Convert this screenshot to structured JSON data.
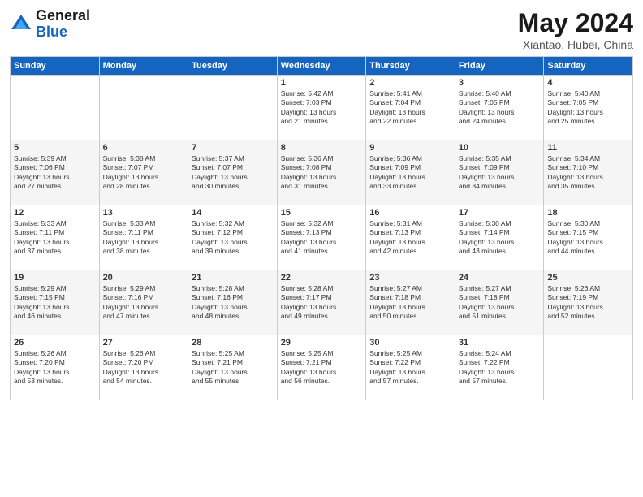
{
  "logo": {
    "general": "General",
    "blue": "Blue"
  },
  "title": "May 2024",
  "subtitle": "Xiantao, Hubei, China",
  "days_of_week": [
    "Sunday",
    "Monday",
    "Tuesday",
    "Wednesday",
    "Thursday",
    "Friday",
    "Saturday"
  ],
  "weeks": [
    [
      {
        "day": "",
        "info": ""
      },
      {
        "day": "",
        "info": ""
      },
      {
        "day": "",
        "info": ""
      },
      {
        "day": "1",
        "info": "Sunrise: 5:42 AM\nSunset: 7:03 PM\nDaylight: 13 hours\nand 21 minutes."
      },
      {
        "day": "2",
        "info": "Sunrise: 5:41 AM\nSunset: 7:04 PM\nDaylight: 13 hours\nand 22 minutes."
      },
      {
        "day": "3",
        "info": "Sunrise: 5:40 AM\nSunset: 7:05 PM\nDaylight: 13 hours\nand 24 minutes."
      },
      {
        "day": "4",
        "info": "Sunrise: 5:40 AM\nSunset: 7:05 PM\nDaylight: 13 hours\nand 25 minutes."
      }
    ],
    [
      {
        "day": "5",
        "info": "Sunrise: 5:39 AM\nSunset: 7:06 PM\nDaylight: 13 hours\nand 27 minutes."
      },
      {
        "day": "6",
        "info": "Sunrise: 5:38 AM\nSunset: 7:07 PM\nDaylight: 13 hours\nand 28 minutes."
      },
      {
        "day": "7",
        "info": "Sunrise: 5:37 AM\nSunset: 7:07 PM\nDaylight: 13 hours\nand 30 minutes."
      },
      {
        "day": "8",
        "info": "Sunrise: 5:36 AM\nSunset: 7:08 PM\nDaylight: 13 hours\nand 31 minutes."
      },
      {
        "day": "9",
        "info": "Sunrise: 5:36 AM\nSunset: 7:09 PM\nDaylight: 13 hours\nand 33 minutes."
      },
      {
        "day": "10",
        "info": "Sunrise: 5:35 AM\nSunset: 7:09 PM\nDaylight: 13 hours\nand 34 minutes."
      },
      {
        "day": "11",
        "info": "Sunrise: 5:34 AM\nSunset: 7:10 PM\nDaylight: 13 hours\nand 35 minutes."
      }
    ],
    [
      {
        "day": "12",
        "info": "Sunrise: 5:33 AM\nSunset: 7:11 PM\nDaylight: 13 hours\nand 37 minutes."
      },
      {
        "day": "13",
        "info": "Sunrise: 5:33 AM\nSunset: 7:11 PM\nDaylight: 13 hours\nand 38 minutes."
      },
      {
        "day": "14",
        "info": "Sunrise: 5:32 AM\nSunset: 7:12 PM\nDaylight: 13 hours\nand 39 minutes."
      },
      {
        "day": "15",
        "info": "Sunrise: 5:32 AM\nSunset: 7:13 PM\nDaylight: 13 hours\nand 41 minutes."
      },
      {
        "day": "16",
        "info": "Sunrise: 5:31 AM\nSunset: 7:13 PM\nDaylight: 13 hours\nand 42 minutes."
      },
      {
        "day": "17",
        "info": "Sunrise: 5:30 AM\nSunset: 7:14 PM\nDaylight: 13 hours\nand 43 minutes."
      },
      {
        "day": "18",
        "info": "Sunrise: 5:30 AM\nSunset: 7:15 PM\nDaylight: 13 hours\nand 44 minutes."
      }
    ],
    [
      {
        "day": "19",
        "info": "Sunrise: 5:29 AM\nSunset: 7:15 PM\nDaylight: 13 hours\nand 46 minutes."
      },
      {
        "day": "20",
        "info": "Sunrise: 5:29 AM\nSunset: 7:16 PM\nDaylight: 13 hours\nand 47 minutes."
      },
      {
        "day": "21",
        "info": "Sunrise: 5:28 AM\nSunset: 7:16 PM\nDaylight: 13 hours\nand 48 minutes."
      },
      {
        "day": "22",
        "info": "Sunrise: 5:28 AM\nSunset: 7:17 PM\nDaylight: 13 hours\nand 49 minutes."
      },
      {
        "day": "23",
        "info": "Sunrise: 5:27 AM\nSunset: 7:18 PM\nDaylight: 13 hours\nand 50 minutes."
      },
      {
        "day": "24",
        "info": "Sunrise: 5:27 AM\nSunset: 7:18 PM\nDaylight: 13 hours\nand 51 minutes."
      },
      {
        "day": "25",
        "info": "Sunrise: 5:26 AM\nSunset: 7:19 PM\nDaylight: 13 hours\nand 52 minutes."
      }
    ],
    [
      {
        "day": "26",
        "info": "Sunrise: 5:26 AM\nSunset: 7:20 PM\nDaylight: 13 hours\nand 53 minutes."
      },
      {
        "day": "27",
        "info": "Sunrise: 5:26 AM\nSunset: 7:20 PM\nDaylight: 13 hours\nand 54 minutes."
      },
      {
        "day": "28",
        "info": "Sunrise: 5:25 AM\nSunset: 7:21 PM\nDaylight: 13 hours\nand 55 minutes."
      },
      {
        "day": "29",
        "info": "Sunrise: 5:25 AM\nSunset: 7:21 PM\nDaylight: 13 hours\nand 56 minutes."
      },
      {
        "day": "30",
        "info": "Sunrise: 5:25 AM\nSunset: 7:22 PM\nDaylight: 13 hours\nand 57 minutes."
      },
      {
        "day": "31",
        "info": "Sunrise: 5:24 AM\nSunset: 7:22 PM\nDaylight: 13 hours\nand 57 minutes."
      },
      {
        "day": "",
        "info": ""
      }
    ]
  ]
}
